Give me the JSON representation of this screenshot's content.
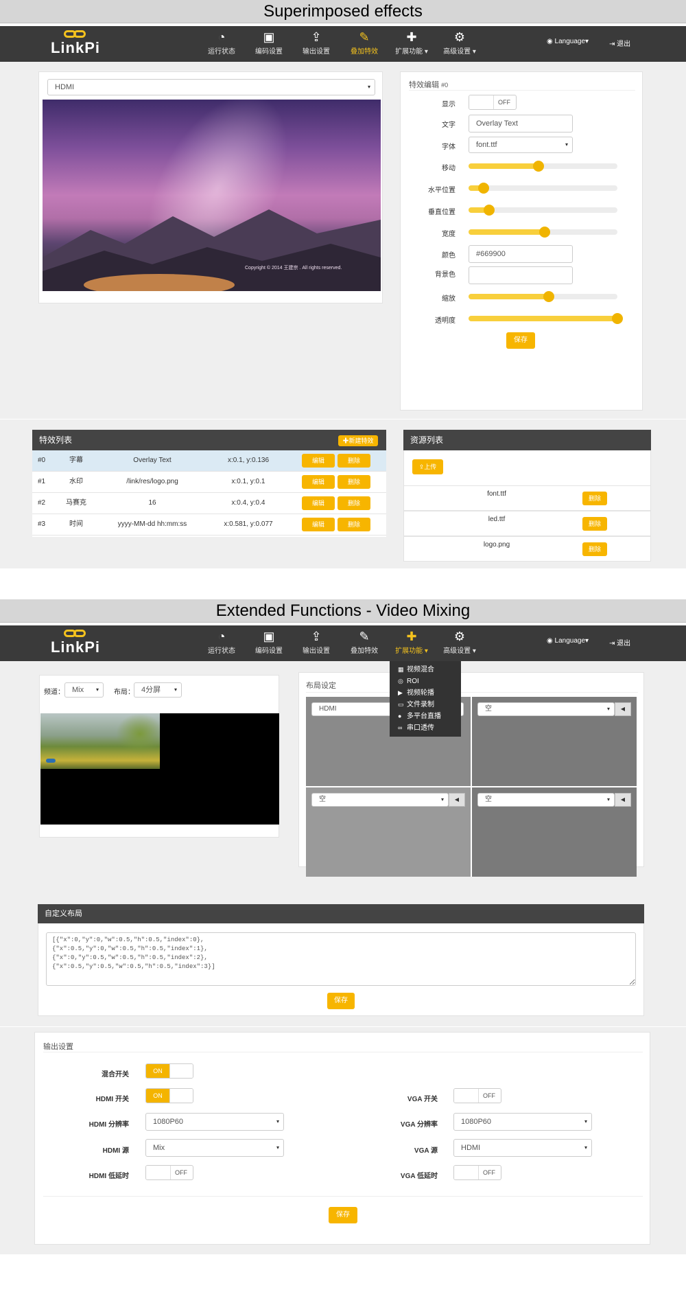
{
  "sections": {
    "effects_title": "Superimposed effects",
    "mixing_title": "Extended Functions - Video Mixing"
  },
  "nav": {
    "logo": "LinkPi",
    "items": [
      "运行状态",
      "编码设置",
      "输出设置",
      "叠加特效",
      "扩展功能",
      "高级设置"
    ],
    "language": "Language",
    "logout": "退出"
  },
  "effects": {
    "source_select": "HDMI",
    "preview_watermark": "Copyright © 2014 王建宗 . All rights reserved.",
    "editor": {
      "title": "特效编辑",
      "index": "#0",
      "show_label": "显示",
      "show_value": "OFF",
      "text_label": "文字",
      "text_value": "Overlay Text",
      "font_label": "字体",
      "font_value": "font.ttf",
      "move_label": "移动",
      "move_value": 0.47,
      "hpos_label": "水平位置",
      "hpos_value": 0.1,
      "vpos_label": "垂直位置",
      "vpos_value": 0.136,
      "width_label": "宽度",
      "width_value": 0.51,
      "color_label": "颜色",
      "color_value": "#669900",
      "bg_label": "背景色",
      "bg_value": "",
      "scale_label": "缩放",
      "scale_value": 0.54,
      "alpha_label": "透明度",
      "alpha_value": 1.0,
      "save": "保存"
    },
    "list": {
      "title": "特效列表",
      "new_button": "新建特效",
      "edit": "编辑",
      "delete": "删除",
      "rows": [
        {
          "id": "#0",
          "type": "字幕",
          "content": "Overlay Text",
          "pos": "x:0.1, y:0.136"
        },
        {
          "id": "#1",
          "type": "水印",
          "content": "/link/res/logo.png",
          "pos": "x:0.1, y:0.1"
        },
        {
          "id": "#2",
          "type": "马赛克",
          "content": "16",
          "pos": "x:0.4, y:0.4"
        },
        {
          "id": "#3",
          "type": "时间",
          "content": "yyyy-MM-dd hh:mm:ss",
          "pos": "x:0.581, y:0.077"
        }
      ]
    },
    "resources": {
      "title": "资源列表",
      "upload": "上传",
      "delete": "删除",
      "files": [
        "font.ttf",
        "led.ttf",
        "logo.png"
      ]
    }
  },
  "mixing": {
    "channel_label": "频道：",
    "channel_value": "Mix",
    "layout_label": "布局：",
    "layout_value": "4分屏",
    "layout_panel_title": "布局设定",
    "quads": [
      "HDMI",
      "空",
      "空",
      "空"
    ],
    "menu": [
      "视频混合",
      "ROI",
      "视频轮播",
      "文件录制",
      "多平台直播",
      "串口透传"
    ],
    "custom_title": "自定义布局",
    "custom_json": "[{\"x\":0,\"y\":0,\"w\":0.5,\"h\":0.5,\"index\":0},\n{\"x\":0.5,\"y\":0,\"w\":0.5,\"h\":0.5,\"index\":1},\n{\"x\":0,\"y\":0.5,\"w\":0.5,\"h\":0.5,\"index\":2},\n{\"x\":0.5,\"y\":0.5,\"w\":0.5,\"h\":0.5,\"index\":3}]",
    "save": "保存",
    "output": {
      "title": "输出设置",
      "mix_switch_label": "混合开关",
      "mix_switch": "ON",
      "hdmi_switch_label": "HDMI 开关",
      "hdmi_switch": "ON",
      "vga_switch_label": "VGA 开关",
      "vga_switch": "OFF",
      "hdmi_res_label": "HDMI 分辨率",
      "hdmi_res": "1080P60",
      "vga_res_label": "VGA 分辨率",
      "vga_res": "1080P60",
      "hdmi_src_label": "HDMI 源",
      "hdmi_src": "Mix",
      "vga_src_label": "VGA 源",
      "vga_src": "HDMI",
      "hdmi_lowlat_label": "HDMI 低延时",
      "hdmi_lowlat": "OFF",
      "vga_lowlat_label": "VGA 低延时",
      "vga_lowlat": "OFF",
      "save": "保存"
    }
  },
  "colors": {
    "accent": "#f7b500",
    "navbar": "#3a3a3a",
    "active_nav": "#f4c21e"
  }
}
